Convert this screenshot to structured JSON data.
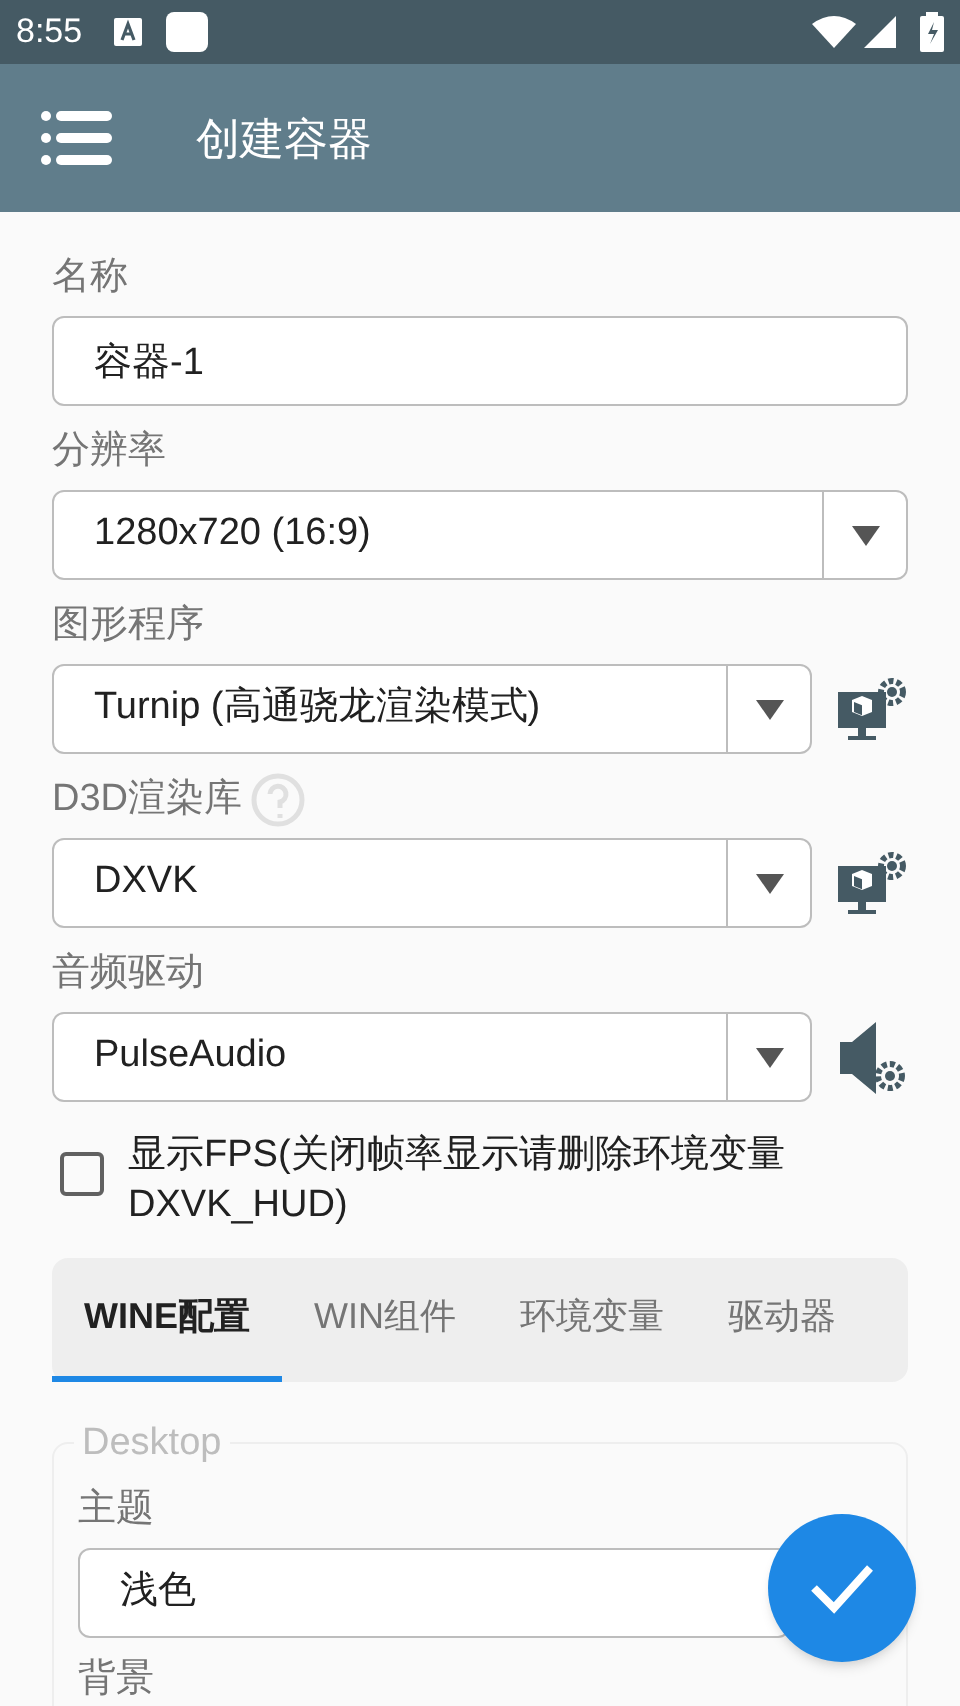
{
  "status_bar": {
    "time": "8:55"
  },
  "toolbar": {
    "title": "创建容器"
  },
  "fields": [
    {
      "label": "名称",
      "kind": "text",
      "value": "容器-1"
    },
    {
      "label": "分辨率",
      "kind": "select",
      "value": "1280x720 (16:9)"
    },
    {
      "label": "图形程序",
      "kind": "select_display_settings",
      "value": "Turnip (高通骁龙渲染模式)"
    },
    {
      "label": "D3D渲染库",
      "kind": "select_display_settings",
      "value": "DXVK",
      "help": true
    },
    {
      "label": "音频驱动",
      "kind": "select_audio_settings",
      "value": "PulseAudio"
    }
  ],
  "show_fps": {
    "label": "显示FPS(关闭帧率显示请删除环境变量DXVK_HUD)",
    "checked": false
  },
  "tabs": [
    {
      "label": "WINE配置",
      "selected": true
    },
    {
      "label": "WIN组件",
      "selected": false
    },
    {
      "label": "环境变量",
      "selected": false
    },
    {
      "label": "驱动器",
      "selected": false
    }
  ],
  "desktop": {
    "legend": "Desktop",
    "fields": [
      {
        "label": "主题",
        "kind": "select_wide",
        "value": "浅色"
      },
      {
        "label": "背景",
        "kind": "label_only"
      }
    ]
  }
}
